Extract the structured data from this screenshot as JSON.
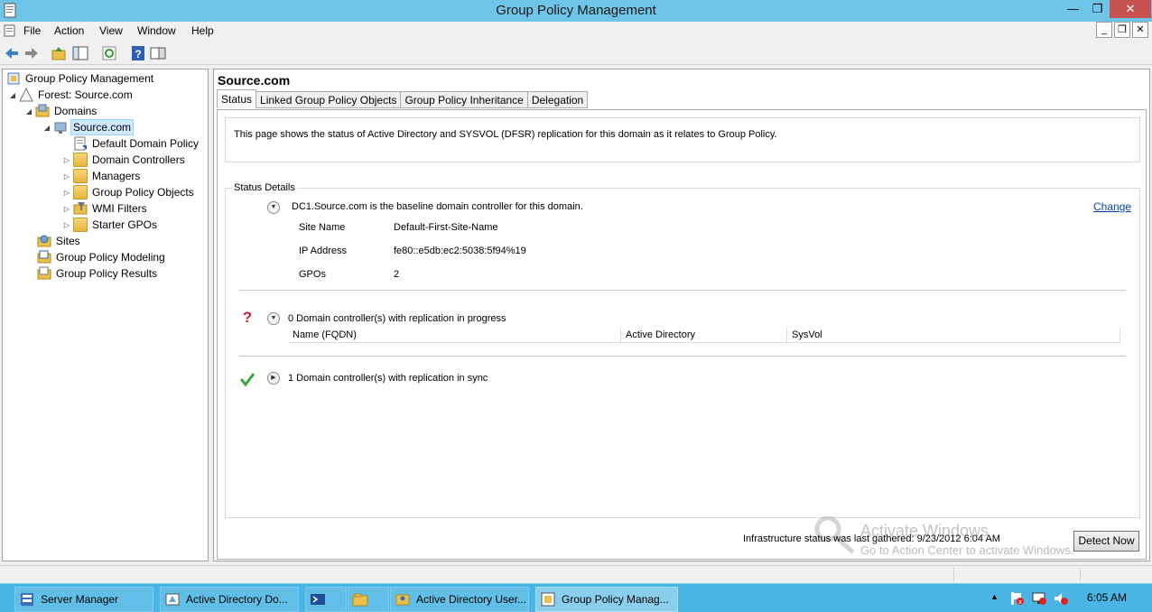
{
  "window": {
    "title": "Group Policy Management"
  },
  "window_controls": {
    "minimize": "—",
    "maximize": "❐",
    "close": "✕"
  },
  "menu": [
    "File",
    "Action",
    "View",
    "Window",
    "Help"
  ],
  "mdi_controls": {
    "minimize": "_",
    "restore": "❐",
    "close": "✕"
  },
  "tree": {
    "root": "Group Policy Management",
    "forest": "Forest: Source.com",
    "domains": "Domains",
    "domain": "Source.com",
    "children": [
      "Default Domain Policy",
      "Domain Controllers",
      "Managers",
      "Group Policy Objects",
      "WMI Filters",
      "Starter GPOs"
    ],
    "sites": "Sites",
    "modeling": "Group Policy Modeling",
    "results": "Group Policy Results"
  },
  "pane": {
    "title": "Source.com",
    "tabs": [
      "Status",
      "Linked Group Policy Objects",
      "Group Policy Inheritance",
      "Delegation"
    ],
    "info": "This page shows the status of Active Directory and SYSVOL (DFSR) replication for this domain as it relates to Group Policy.",
    "status_details_label": "Status Details",
    "baseline": "DC1.Source.com is the baseline domain controller for this domain.",
    "change_link": "Change",
    "site_name_label": "Site Name",
    "site_name_value": "Default-First-Site-Name",
    "ip_label": "IP Address",
    "ip_value": "fe80::e5db:ec2:5038:5f94%19",
    "gpos_label": "GPOs",
    "gpos_value": "2",
    "in_progress": "0 Domain controller(s) with replication in progress",
    "columns": [
      "Name (FQDN)",
      "Active Directory",
      "SysVol"
    ],
    "in_sync": "1 Domain controller(s) with replication in sync",
    "gathered": "Infrastructure status was last gathered: 9/23/2012 6:04 AM",
    "detect_now": "Detect Now"
  },
  "watermark": {
    "line1": "Activate Windows",
    "line2": "Go to Action Center to activate Windows."
  },
  "taskbar": {
    "items": [
      "Server Manager",
      "Active Directory Do...",
      "",
      "",
      "Active Directory User...",
      "Group Policy Manag..."
    ],
    "clock": "6:05 AM"
  },
  "colors": {
    "titlebar": "#6fc5e8",
    "taskbar": "#4ab5e4",
    "link": "#0645ad",
    "selection": "#cde8ff"
  }
}
